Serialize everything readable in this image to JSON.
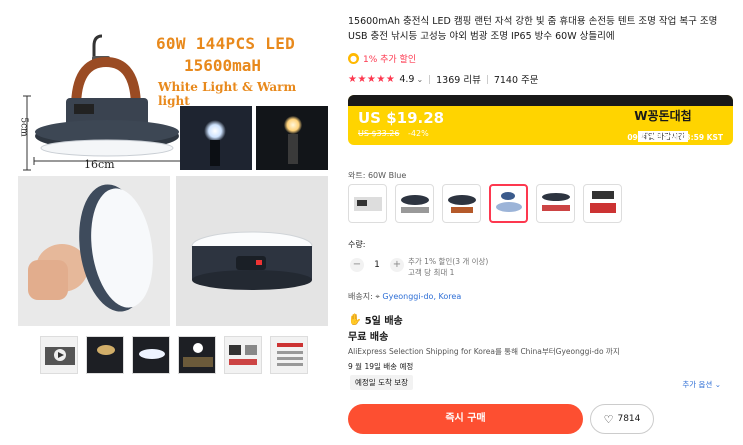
{
  "gallery": {
    "promo_line1": "60W 144PCS LED",
    "promo_line2": "15600maH",
    "promo_line3": "White Light & Warm light",
    "dimension_width": "16cm",
    "dimension_height": "5cm",
    "thumbnails": [
      "play-video-thumb",
      "night-scene",
      "lamp-dark",
      "lamp-outdoor",
      "product-variants",
      "spec-sheet"
    ]
  },
  "product": {
    "title": "15600mAh 충전식 LED 캠핑 랜턴 자석 강한 빛 줌 휴대용 손전등 텐트 조명 작업 복구 조명 USB 충전 낚시등 고성능 야외 범광 조명 IP65 방수 60W 상들리에",
    "coin_promo": "1% 추가 할인",
    "rating": "4.9",
    "reviews": "1369 리뷰",
    "orders": "7140 주문"
  },
  "price": {
    "current": "US $19.28",
    "original": "US $33.26",
    "discount": "-42%",
    "promo_title": "W꽁돈대첩",
    "promo_sub": "세일 마감시간",
    "promo_end": "09월19일 PM 03:59 KST"
  },
  "variant": {
    "label": "와트: 60W Blue",
    "selected_index": 3
  },
  "quantity": {
    "label": "수량:",
    "minus": "−",
    "value": "1",
    "plus": "+",
    "note_line1": "추가 1% 할인(3 개 이상)",
    "note_line2": "고객 당 최대 1"
  },
  "shipping": {
    "to_label": "배송지:",
    "location": "Gyeonggi-do, Korea",
    "days": "5일 배송",
    "free": "무료 배송",
    "description": "AliExpress Selection Shipping for Korea를 통해 China부터Gyeonggi-do 까지",
    "eta": "9 월 19일 배송 예정",
    "guarantee": "예정일 도착 보장",
    "more_options": "추가 옵션"
  },
  "actions": {
    "buy_now": "즉시 구매",
    "wishlist_count": "7814"
  },
  "colors": {
    "accent": "#fd384f",
    "buy": "#fd4f31",
    "banner": "#ffd400",
    "link": "#2f6fd6"
  }
}
